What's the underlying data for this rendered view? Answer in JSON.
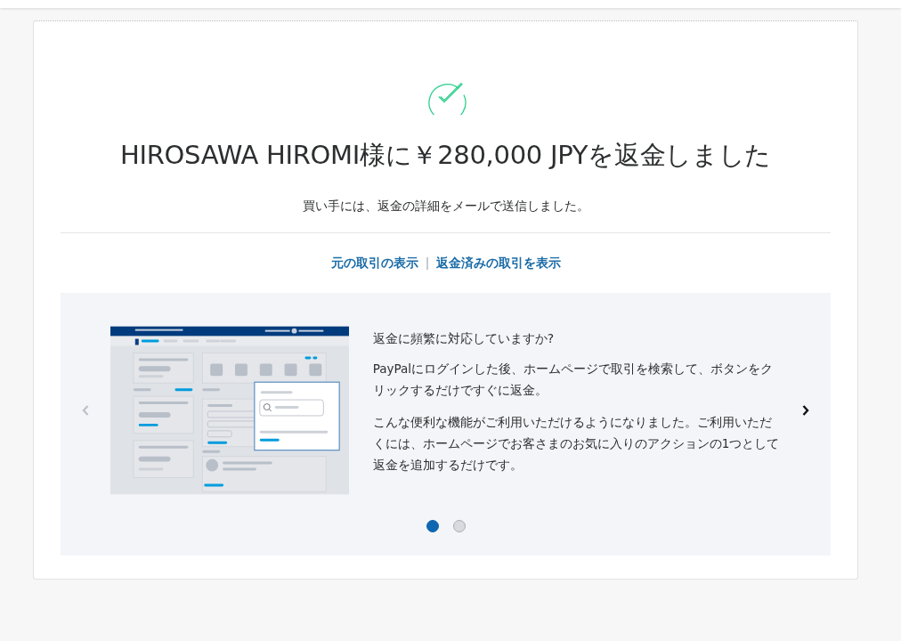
{
  "title": "HIROSAWA HIROMI様に￥280,000 JPYを返金しました",
  "subtitle": "買い手には、返金の詳細をメールで送信しました。",
  "links": [
    "元の取引の表示",
    "返金済みの取引を表示"
  ],
  "promo": {
    "title": "返金に頻繁に対応していますか?",
    "paragraphs": [
      "PayPalにログインした後、ホームページで取引を検索して、ボタンをクリックするだけですぐに返金。",
      "こんな便利な機能がご利用いただけるようになりました。ご利用いただくには、ホームページでお客さまのお気に入りのアクションの1つとして返金を追加するだけです。"
    ]
  },
  "dots": [
    {
      "selected": true
    },
    {
      "selected": false
    }
  ]
}
